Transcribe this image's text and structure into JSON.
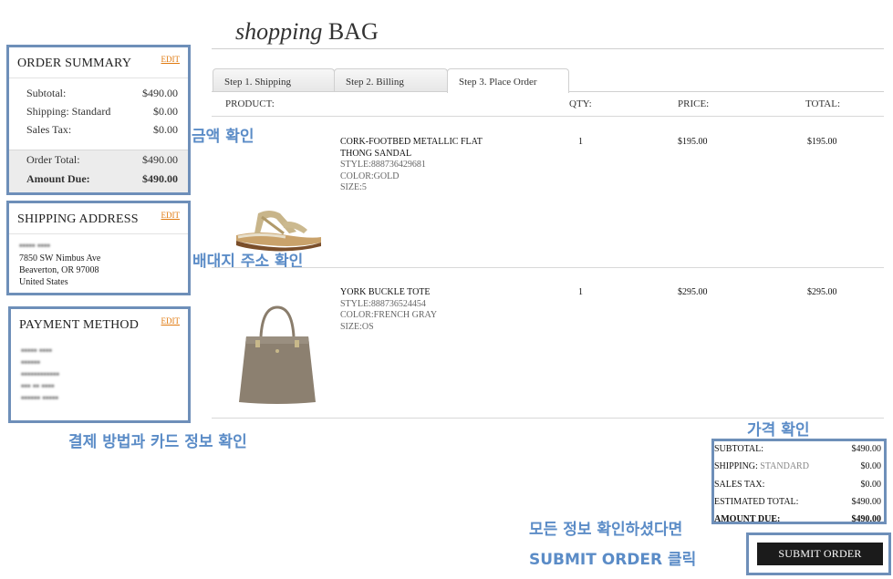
{
  "page": {
    "title_italic": "shopping",
    "title_rest": " BAG"
  },
  "order_summary": {
    "title": "ORDER SUMMARY",
    "edit": "EDIT",
    "rows": [
      {
        "label": "Subtotal:",
        "value": "$490.00"
      },
      {
        "label": "Shipping: Standard",
        "value": "$0.00"
      },
      {
        "label": "Sales Tax:",
        "value": "$0.00"
      }
    ],
    "order_total_label": "Order Total:",
    "order_total_value": "$490.00",
    "amount_due_label": "Amount Due:",
    "amount_due_value": "$490.00"
  },
  "shipping_address": {
    "title": "SHIPPING ADDRESS",
    "edit": "EDIT",
    "name": "••••• ••••",
    "street": "7850 SW Nimbus Ave",
    "city": "Beaverton, OR 97008",
    "country": "United States"
  },
  "payment_method": {
    "title": "PAYMENT METHOD",
    "edit": "EDIT",
    "lines": [
      "••••• ••••",
      "••••••",
      "••••••••••••",
      "••• •• ••••",
      "•••••• •••••"
    ]
  },
  "annotations": {
    "amount_check": "금액 확인",
    "address_check": "배대지 주소 확인",
    "payment_check": "결제 방법과 카드 정보 확인",
    "price_check": "가격 확인",
    "submit_line1": "모든 정보 확인하셨다면",
    "submit_line2": "SUBMIT ORDER 클릭"
  },
  "tabs": [
    {
      "label": "Step 1. Shipping"
    },
    {
      "label": "Step 2. Billing"
    },
    {
      "label": "Step 3. Place Order",
      "active": true
    }
  ],
  "columns": {
    "product": "PRODUCT:",
    "qty": "QTY:",
    "price": "PRICE:",
    "total": "TOTAL:"
  },
  "items": [
    {
      "name_line1": "CORK-FOOTBED METALLIC FLAT",
      "name_line2": "THONG SANDAL",
      "style": "STYLE:888736429681",
      "color": "COLOR:GOLD",
      "size": "SIZE:5",
      "qty": "1",
      "price": "$195.00",
      "total": "$195.00"
    },
    {
      "name_line1": "YORK BUCKLE TOTE",
      "style": "STYLE:888736524454",
      "color": "COLOR:FRENCH GRAY",
      "size": "SIZE:OS",
      "qty": "1",
      "price": "$295.00",
      "total": "$295.00"
    }
  ],
  "totals": {
    "subtotal_label": "SUBTOTAL:",
    "subtotal_value": "$490.00",
    "shipping_label": "SHIPPING:",
    "shipping_method": "STANDARD",
    "shipping_value": "$0.00",
    "tax_label": "SALES TAX:",
    "tax_value": "$0.00",
    "estimated_label": "ESTIMATED TOTAL:",
    "estimated_value": "$490.00",
    "due_label": "AMOUNT DUE:",
    "due_value": "$490.00"
  },
  "submit": {
    "label": "SUBMIT ORDER"
  },
  "colors": {
    "annotation_blue": "#5b8cc7",
    "annotation_border": "#6e8fb9",
    "edit_orange": "#e07a10",
    "button_dark": "#1b1b1b"
  }
}
